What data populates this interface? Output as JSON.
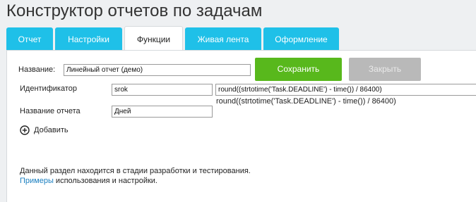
{
  "page": {
    "title": "Конструктор отчетов по задачам"
  },
  "tabs": [
    {
      "label": "Отчет",
      "active": false
    },
    {
      "label": "Настройки",
      "active": false
    },
    {
      "label": "Функции",
      "active": true
    },
    {
      "label": "Живая лента",
      "active": false
    },
    {
      "label": "Оформление",
      "active": false
    }
  ],
  "form": {
    "name_label": "Название:",
    "name_value": "Линейный отчет (демо)",
    "save_label": "Сохранить",
    "close_label": "Закрыть",
    "identifier_label": "Идентификатор",
    "identifier_value": "srok",
    "formula_value": "round((strtotime('Task.DEADLINE') - time()) / 86400)",
    "formula_preview": "round((strtotime('Task.DEADLINE') - time()) / 86400)",
    "report_name_label": "Название отчета",
    "report_name_value": "Дней",
    "add_label": "Добавить"
  },
  "footer": {
    "note": "Данный раздел находится в стадии разработки и тестирования.",
    "examples_link": "Примеры",
    "examples_rest": " использования и настройки."
  }
}
